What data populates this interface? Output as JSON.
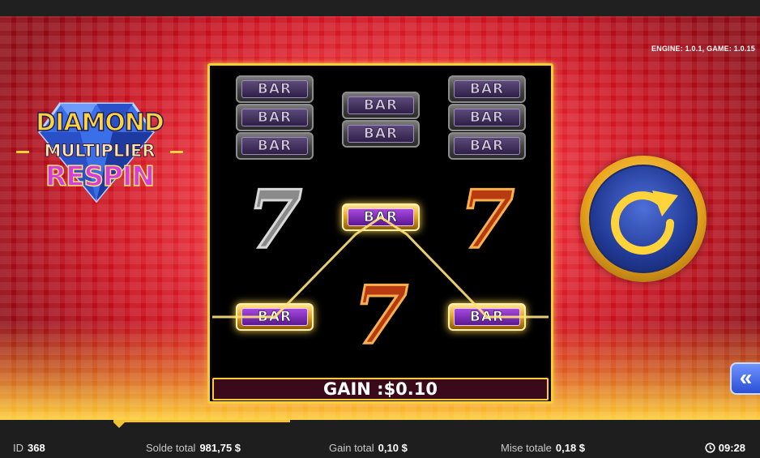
{
  "game": {
    "logo": {
      "line1": "DIAMOND",
      "line2": "MULTIPLIER",
      "line3": "RESPIN"
    },
    "version": "ENGINE: 1.0.1, GAME: 1.0.15",
    "reels": [
      {
        "symbols": [
          "BAR",
          "BAR",
          "BAR",
          "7",
          "BAR"
        ]
      },
      {
        "symbols": [
          "BAR",
          "BAR",
          "BAR",
          "7"
        ]
      },
      {
        "symbols": [
          "BAR",
          "BAR",
          "BAR",
          "7",
          "BAR"
        ]
      }
    ],
    "winning_symbols": [
      "BAR",
      "BAR",
      "BAR"
    ],
    "gain_text": "GAIN :$0.10",
    "spin_button": "spin-icon",
    "side_menu_button": "chevron-double-left-icon"
  },
  "status": {
    "id_label": "ID",
    "id_value": "368",
    "balance_label": "Solde total",
    "balance_value": "981,75 $",
    "gain_label": "Gain total",
    "gain_value": "0,10 $",
    "bet_label": "Mise totale",
    "bet_value": "0,18 $",
    "time": "09:28"
  },
  "colors": {
    "accent": "#f1c232",
    "frame_gold": "#ffcc33",
    "background_red": "#e0202e",
    "spin_blue": "#223a96"
  }
}
